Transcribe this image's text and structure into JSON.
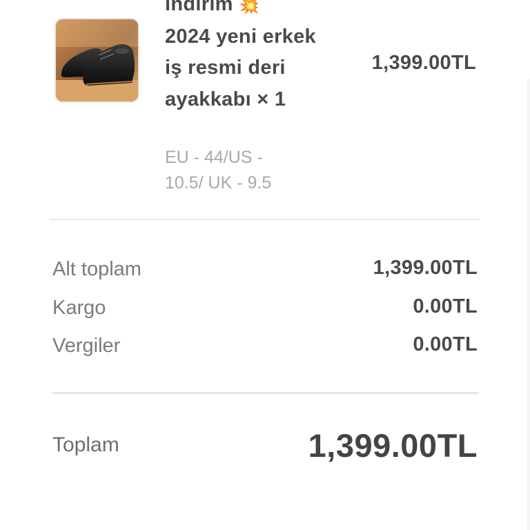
{
  "order": {
    "product": {
      "title_first_line": "indirim",
      "burst_icon": "💥",
      "title_rest": "2024 yeni erkek iş resmi deri ayakkabı × 1",
      "variant": "EU - 44/US - 10.5/ UK - 9.5",
      "price": "1,399.00TL",
      "image": "black-leather-dress-shoes"
    },
    "summary": {
      "subtotal_label": "Alt toplam",
      "subtotal_value": "1,399.00TL",
      "shipping_label": "Kargo",
      "shipping_value": "0.00TL",
      "taxes_label": "Vergiler",
      "taxes_value": "0.00TL"
    },
    "total": {
      "label": "Toplam",
      "value": "1,399.00TL"
    }
  }
}
